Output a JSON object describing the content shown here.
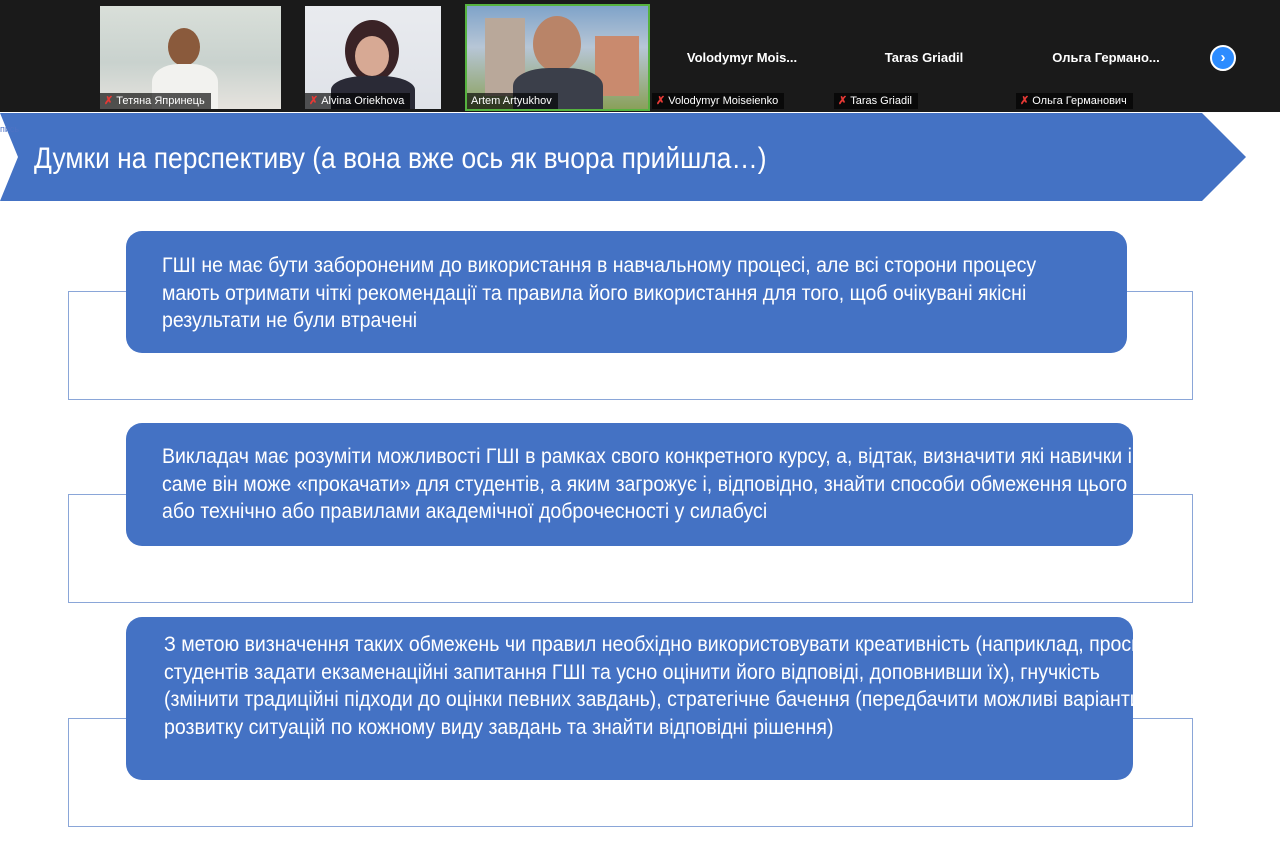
{
  "participants": [
    {
      "name": "Тетяна Япринець",
      "has_video": true,
      "muted": true
    },
    {
      "name": "Alvina Oriekhova",
      "has_video": true,
      "muted": true
    },
    {
      "name": "Artem Artyukhov",
      "has_video": true,
      "muted": false,
      "active_speaker": true
    },
    {
      "display_name": "Volodymyr  Mois...",
      "name": "Volodymyr Moiseienko",
      "has_video": false,
      "muted": true
    },
    {
      "display_name": "Taras Griadil",
      "name": "Taras Griadil",
      "has_video": false,
      "muted": true
    },
    {
      "display_name": "Ольга  Германо...",
      "name": "Ольга Германович",
      "has_video": false,
      "muted": true
    }
  ],
  "controls": {
    "next_page_icon": "chevron-right-icon"
  },
  "slide": {
    "recording_label": "пись",
    "title": "Думки на перспективу (а вона вже ось як вчора прийшла…)",
    "points": [
      "ГШІ не має бути забороненим до використання в навчальному процесі, але всі сторони процесу мають отримати чіткі рекомендації та правила його використання для того, щоб очікувані якісні результати не були втрачені",
      "Викладач має розуміти можливості ГШІ в рамках свого конкретного курсу, а, відтак, визначити які навички і як саме він може «прокачати» для студентів, а яким загрожує і, відповідно, знайти способи обмеження цього або технічно або правилами академічної доброчесності у силабусі",
      "З метою визначення таких обмежень чи правил необхідно використовувати креативність (наприклад, просити студентів задати екзаменаційні запитання ГШІ та усно оцінити його відповіді, доповнивши їх), гнучкість (змінити традиційні підходи до оцінки певних завдань), стратегічне бачення (передбачити можливі варіанти розвитку ситуацій по кожному виду завдань та знайти відповідні рішення)"
    ]
  },
  "colors": {
    "slide_accent": "#4472c4",
    "strip_bg": "#1a1a1a",
    "active_speaker": "#56b23f",
    "muted_icon": "#e53935",
    "nav_button": "#2d8cff"
  }
}
